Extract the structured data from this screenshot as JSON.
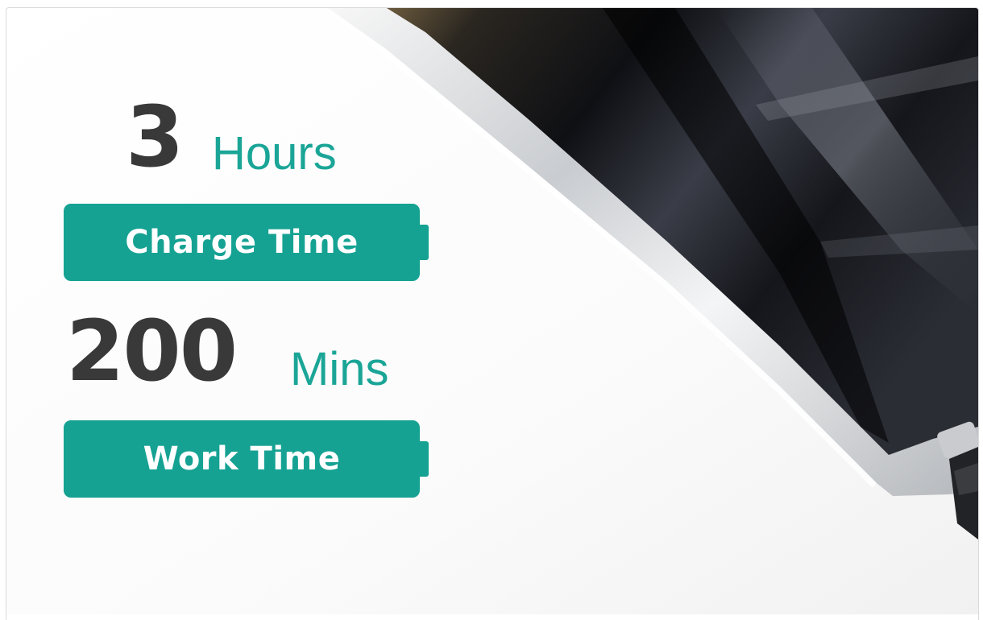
{
  "charge": {
    "number": "3",
    "unit": "Hours",
    "label": "Charge Time"
  },
  "work": {
    "number": "200",
    "unit": "Mins",
    "label": "Work Time"
  },
  "colors": {
    "accent": "#15a293",
    "unit_text": "#1aa597",
    "number_text": "#393939",
    "device_dark": "#14161c",
    "device_chrome": "#dcdfe2"
  },
  "icons": [
    "battery-icon",
    "battery-icon"
  ]
}
